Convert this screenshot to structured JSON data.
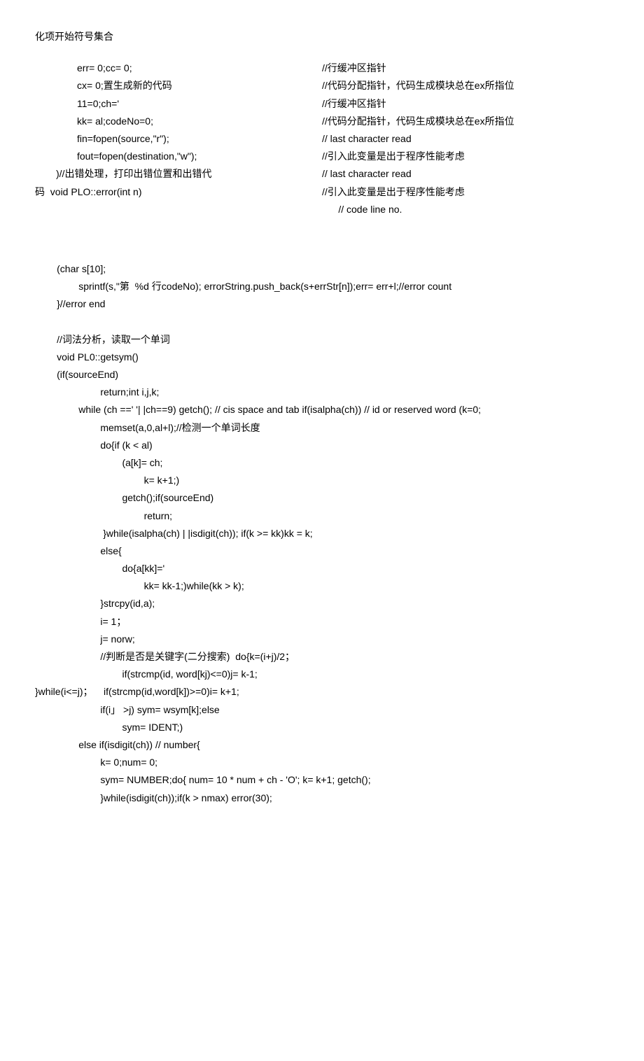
{
  "header": "化项开始符号集合",
  "left": {
    "l1": "err= 0;cc= 0;",
    "l2": "cx= 0;置生成新的代码",
    "l3": "11=0;ch='",
    "l4": "kk= al;codeNo=0;",
    "l5": "fin=fopen(source,\"r\");",
    "l6": "fout=fopen(destination,\"w\");",
    "l7": ")//出错处理，打印出错位置和出错代",
    "l8": "码  void PLO::error(int n)"
  },
  "right": {
    "r0": "//行缓冲区指针",
    "r1": "//代码分配指针，代码生成模块总在ex所指位",
    "r2": "//行缓冲区指针",
    "r3": "//代码分配指针，代码生成模块总在ex所指位",
    "r4": "// last character read",
    "r5": "//引入此变量是出于程序性能考虑",
    "r6": "// last character read",
    "r7": "//引入此变量是出于程序性能考虑",
    "r8": "      // code line no."
  },
  "code": {
    "block1": "        (char s[10];\n                sprintf(s,\"第  %d 行codeNo); errorString.push_back(s+errStr[n]);err= err+l;//error count\n        }//error end\n\n        //词法分析，读取一个单词\n        void PL0::getsym()\n        (if(sourceEnd)\n                        return;int i,j,k;\n                while (ch ==' '| |ch==9) getch(); // cis space and tab if(isalpha(ch)) // id or reserved word (k=0;\n                        memset(a,0,al+l);//检测一个单词长度\n                        do{if (k < al)\n                                (a[k]= ch;\n                                        k= k+1;)\n                                getch();if(sourceEnd)\n                                        return;\n                         }while(isalpha(ch) | |isdigit(ch)); if(k >= kk)kk = k;\n                        else{\n                                do{a[kk]='\n                                        kk= kk-1;)while(kk > k);\n                        }strcpy(id,a);\n                        i= 1；\n                        j= norw;\n                        //判断是否是关键字(二分搜索)  do{k=(i+j)/2；\n                                if(strcmp(id, word[kj)<=0)j= k-1;\n}while(i<=j)；    if(strcmp(id,word[k])>=0)i= k+1;\n                        if(i」 >j) sym= wsym[k];else\n                                sym= IDENT;)\n                else if(isdigit(ch)) // number{\n                        k= 0;num= 0;\n                        sym= NUMBER;do{ num= 10 * num + ch - 'O'; k= k+1; getch();\n                        }while(isdigit(ch));if(k > nmax) error(30);"
  }
}
